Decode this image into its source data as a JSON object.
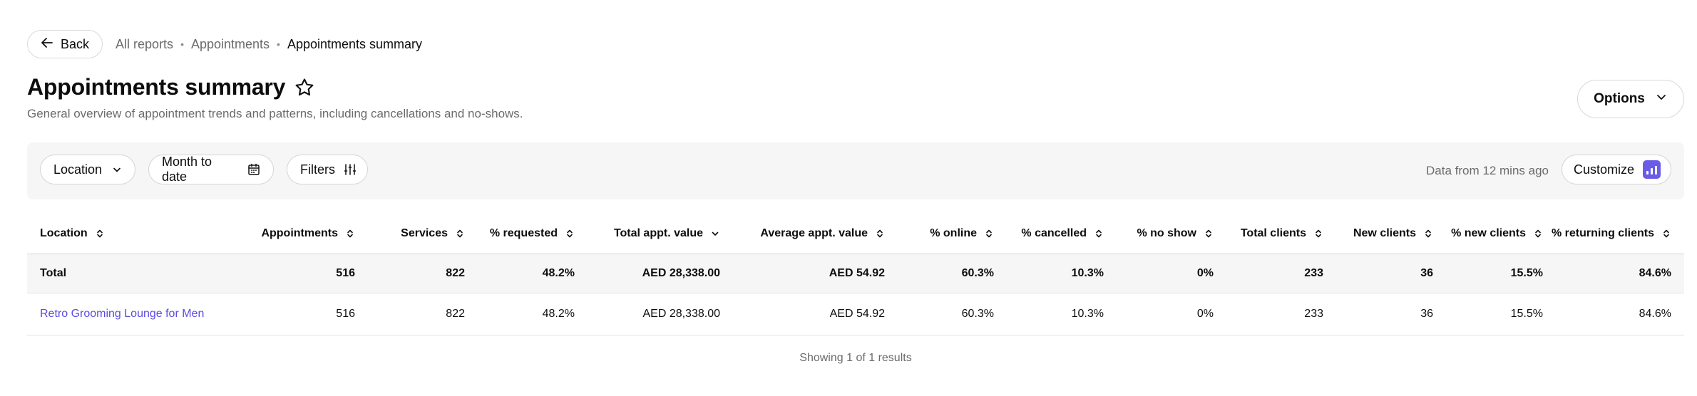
{
  "nav": {
    "back_label": "Back",
    "breadcrumbs": [
      "All reports",
      "Appointments",
      "Appointments summary"
    ]
  },
  "page": {
    "title": "Appointments summary",
    "subtitle": "General overview of appointment trends and patterns, including cancellations and no-shows.",
    "options_label": "Options"
  },
  "filters": {
    "location_label": "Location",
    "date_label": "Month to date",
    "filters_label": "Filters",
    "data_from": "Data from 12 mins ago",
    "customize_label": "Customize"
  },
  "table": {
    "columns": [
      "Location",
      "Appointments",
      "Services",
      "% requested",
      "Total appt. value",
      "Average appt. value",
      "% online",
      "% cancelled",
      "% no show",
      "Total clients",
      "New clients",
      "% new clients",
      "% returning clients"
    ],
    "total_row": [
      "Total",
      "516",
      "822",
      "48.2%",
      "AED 28,338.00",
      "AED 54.92",
      "60.3%",
      "10.3%",
      "0%",
      "233",
      "36",
      "15.5%",
      "84.6%"
    ],
    "rows": [
      [
        "Retro Grooming Lounge for Men",
        "516",
        "822",
        "48.2%",
        "AED 28,338.00",
        "AED 54.92",
        "60.3%",
        "10.3%",
        "0%",
        "233",
        "36",
        "15.5%",
        "84.6%"
      ]
    ]
  },
  "footer": {
    "results_text": "Showing 1 of 1 results"
  },
  "colors": {
    "accent": "#6b5ce7",
    "link": "#5b4ce0",
    "filter_bg": "#f6f6f6"
  },
  "icons": {
    "back": "arrow-left-icon",
    "star": "star-outline-icon",
    "options": "chevron-down-icon",
    "location": "chevron-down-icon",
    "date": "calendar-icon",
    "filters": "sliders-icon",
    "customize": "bar-chart-icon",
    "sort": "sort-icon",
    "sort_active": "sort-desc-icon"
  }
}
